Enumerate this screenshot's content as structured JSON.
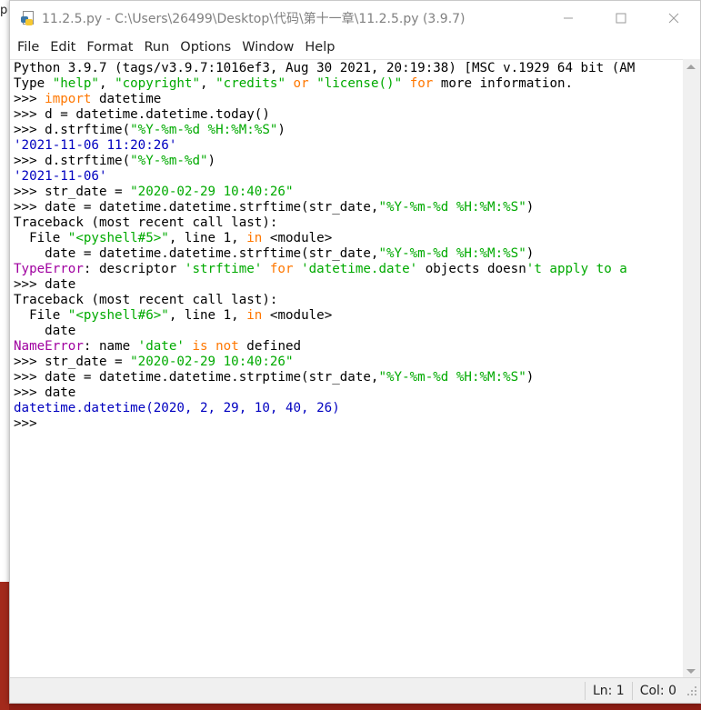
{
  "window": {
    "title": "11.2.5.py - C:\\Users\\26499\\Desktop\\代码\\第十一章\\11.2.5.py (3.9.7)",
    "icon": "python-idle-icon"
  },
  "window_controls": {
    "minimize": "minimize-icon",
    "maximize": "maximize-icon",
    "close": "close-icon"
  },
  "menu": {
    "items": [
      "File",
      "Edit",
      "Format",
      "Run",
      "Options",
      "Window",
      "Help"
    ]
  },
  "editor": {
    "lines": [
      [
        {
          "t": "Python 3.9.7 (tags/v3.9.7:1016ef3, Aug 30 2021, 20:19:38) [MSC v.1929 64 bit (AM",
          "c": ""
        }
      ],
      [
        {
          "t": "Type ",
          "c": ""
        },
        {
          "t": "\"help\"",
          "c": "str"
        },
        {
          "t": ", ",
          "c": ""
        },
        {
          "t": "\"copyright\"",
          "c": "str"
        },
        {
          "t": ", ",
          "c": ""
        },
        {
          "t": "\"credits\"",
          "c": "str"
        },
        {
          "t": " ",
          "c": ""
        },
        {
          "t": "or",
          "c": "kw"
        },
        {
          "t": " ",
          "c": ""
        },
        {
          "t": "\"license()\"",
          "c": "str"
        },
        {
          "t": " ",
          "c": ""
        },
        {
          "t": "for",
          "c": "kw"
        },
        {
          "t": " more information.",
          "c": ""
        }
      ],
      [
        {
          "t": ">>> ",
          "c": ""
        },
        {
          "t": "import",
          "c": "kw"
        },
        {
          "t": " datetime",
          "c": ""
        }
      ],
      [
        {
          "t": ">>> d = datetime.datetime.today()",
          "c": ""
        }
      ],
      [
        {
          "t": ">>> d.strftime(",
          "c": ""
        },
        {
          "t": "\"%Y-%m-%d %H:%M:%S\"",
          "c": "str"
        },
        {
          "t": ")",
          "c": ""
        }
      ],
      [
        {
          "t": "'2021-11-06 11:20:26'",
          "c": "out"
        }
      ],
      [
        {
          "t": ">>> d.strftime(",
          "c": ""
        },
        {
          "t": "\"%Y-%m-%d\"",
          "c": "str"
        },
        {
          "t": ")",
          "c": ""
        }
      ],
      [
        {
          "t": "'2021-11-06'",
          "c": "out"
        }
      ],
      [
        {
          "t": ">>> str_date = ",
          "c": ""
        },
        {
          "t": "\"2020-02-29 10:40:26\"",
          "c": "str"
        }
      ],
      [
        {
          "t": ">>> date = datetime.datetime.strftime(str_date,",
          "c": ""
        },
        {
          "t": "\"%Y-%m-%d %H:%M:%S\"",
          "c": "str"
        },
        {
          "t": ")",
          "c": ""
        }
      ],
      [
        {
          "t": "Traceback (most recent call last):",
          "c": ""
        }
      ],
      [
        {
          "t": "  File ",
          "c": ""
        },
        {
          "t": "\"<pyshell#5>\"",
          "c": "str"
        },
        {
          "t": ", line 1, ",
          "c": ""
        },
        {
          "t": "in",
          "c": "kw"
        },
        {
          "t": " <module>",
          "c": ""
        }
      ],
      [
        {
          "t": "    date = datetime.datetime.strftime(str_date,",
          "c": ""
        },
        {
          "t": "\"%Y-%m-%d %H:%M:%S\"",
          "c": "str"
        },
        {
          "t": ")",
          "c": ""
        }
      ],
      [
        {
          "t": "TypeError",
          "c": "err"
        },
        {
          "t": ": descriptor ",
          "c": ""
        },
        {
          "t": "'strftime'",
          "c": "str"
        },
        {
          "t": " ",
          "c": ""
        },
        {
          "t": "for",
          "c": "kw"
        },
        {
          "t": " ",
          "c": ""
        },
        {
          "t": "'datetime.date'",
          "c": "str"
        },
        {
          "t": " objects doesn",
          "c": ""
        },
        {
          "t": "'t apply to a",
          "c": "str"
        }
      ],
      [
        {
          "t": ">>> date",
          "c": ""
        }
      ],
      [
        {
          "t": "Traceback (most recent call last):",
          "c": ""
        }
      ],
      [
        {
          "t": "  File ",
          "c": ""
        },
        {
          "t": "\"<pyshell#6>\"",
          "c": "str"
        },
        {
          "t": ", line 1, ",
          "c": ""
        },
        {
          "t": "in",
          "c": "kw"
        },
        {
          "t": " <module>",
          "c": ""
        }
      ],
      [
        {
          "t": "    date",
          "c": ""
        }
      ],
      [
        {
          "t": "NameError",
          "c": "err"
        },
        {
          "t": ": name ",
          "c": ""
        },
        {
          "t": "'date'",
          "c": "str"
        },
        {
          "t": " ",
          "c": ""
        },
        {
          "t": "is",
          "c": "kw"
        },
        {
          "t": " ",
          "c": ""
        },
        {
          "t": "not",
          "c": "kw"
        },
        {
          "t": " defined",
          "c": ""
        }
      ],
      [
        {
          "t": ">>> str_date = ",
          "c": ""
        },
        {
          "t": "\"2020-02-29 10:40:26\"",
          "c": "str"
        }
      ],
      [
        {
          "t": ">>> date = datetime.datetime.strptime(str_date,",
          "c": ""
        },
        {
          "t": "\"%Y-%m-%d %H:%M:%S\"",
          "c": "str"
        },
        {
          "t": ")",
          "c": ""
        }
      ],
      [
        {
          "t": ">>> date",
          "c": ""
        }
      ],
      [
        {
          "t": "datetime.datetime(2020, 2, 29, 10, 40, 26)",
          "c": "out"
        }
      ],
      [
        {
          "t": ">>> ",
          "c": ""
        }
      ]
    ]
  },
  "status": {
    "line": "Ln: 1",
    "col": "Col: 0"
  },
  "desktop": {
    "edge_char": "p"
  },
  "colors": {
    "keyword": "#ff7700",
    "string": "#00aa00",
    "output": "#0000c0",
    "error": "#a000a0"
  }
}
